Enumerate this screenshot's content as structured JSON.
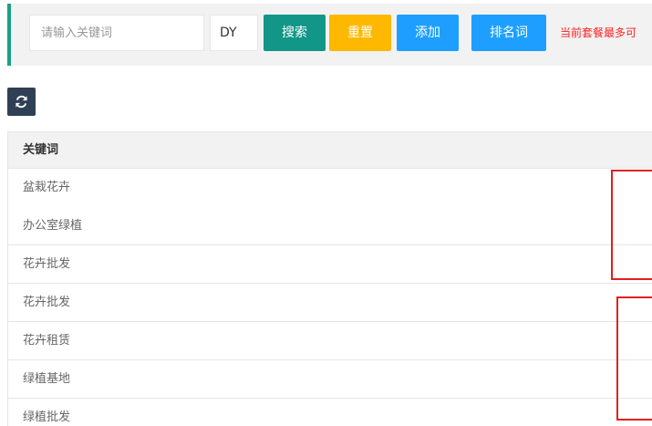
{
  "toolbar": {
    "keyword_placeholder": "请输入关键词",
    "keyword_value": "",
    "platform_value": "DY",
    "search_label": "搜索",
    "reset_label": "重置",
    "add_label": "添加",
    "rank_label": "排名词",
    "notice_text": "当前套餐最多可"
  },
  "refresh": {
    "icon": "refresh-icon"
  },
  "table": {
    "header": "关键词",
    "rows": [
      "盆栽花卉",
      "办公室绿植",
      "花卉批发",
      "花卉批发",
      "花卉租赁",
      "绿植基地",
      "绿植批发"
    ]
  },
  "colors": {
    "accent_border": "#1e9f86",
    "search": "#119688",
    "reset": "#ffb800",
    "primary": "#1e9fff",
    "dark": "#2f4056",
    "notice": "#ff2222",
    "highlight_box": "#e02020"
  }
}
